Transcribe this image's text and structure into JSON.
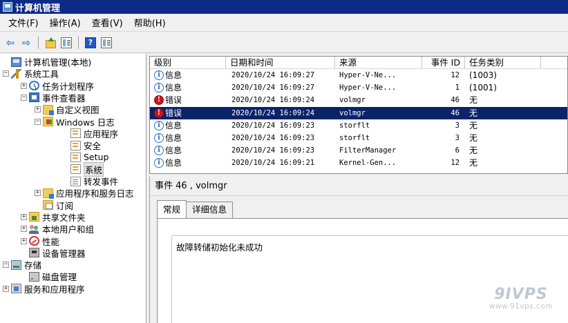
{
  "window": {
    "title": "计算机管理"
  },
  "menu": [
    "文件(F)",
    "操作(A)",
    "查看(V)",
    "帮助(H)"
  ],
  "toolbar": {
    "help_glyph": "?"
  },
  "tree": [
    {
      "label": "计算机管理(本地)",
      "exp": "none",
      "icon": "computer-icon",
      "cls": "ic-computer",
      "level": 0
    },
    {
      "label": "系统工具",
      "exp": "−",
      "icon": "tools-icon",
      "cls": "ic-tools",
      "level": 0
    },
    {
      "label": "任务计划程序",
      "exp": "+",
      "icon": "clock-icon",
      "cls": "ic-clock",
      "level": 1
    },
    {
      "label": "事件查看器",
      "exp": "−",
      "icon": "event-viewer-icon",
      "cls": "ic-log",
      "level": 1
    },
    {
      "label": "自定义视图",
      "exp": "+",
      "icon": "folder-icon",
      "cls": "ic-folder",
      "level": 2
    },
    {
      "label": "Windows 日志",
      "exp": "−",
      "icon": "windows-folder-icon",
      "cls": "ic-winfolder",
      "level": 2
    },
    {
      "label": "应用程序",
      "exp": "none",
      "icon": "log-icon",
      "cls": "ic-logfile",
      "level": 3
    },
    {
      "label": "安全",
      "exp": "none",
      "icon": "log-icon",
      "cls": "ic-logfile",
      "level": 3
    },
    {
      "label": "Setup",
      "exp": "none",
      "icon": "log-icon",
      "cls": "ic-logfile",
      "level": 3
    },
    {
      "label": "系统",
      "exp": "none",
      "icon": "log-icon",
      "cls": "ic-logfile",
      "level": 3,
      "selected": true
    },
    {
      "label": "转发事件",
      "exp": "none",
      "icon": "log-icon",
      "cls": "ic-logfile-plain",
      "level": 3
    },
    {
      "label": "应用程序和服务日志",
      "exp": "+",
      "icon": "folder-icon",
      "cls": "ic-folder",
      "level": 2
    },
    {
      "label": "订阅",
      "exp": "none",
      "icon": "subscription-icon",
      "cls": "ic-subscribe",
      "level": 2
    },
    {
      "label": "共享文件夹",
      "exp": "+",
      "icon": "shared-folder-icon",
      "cls": "ic-share",
      "level": 1
    },
    {
      "label": "本地用户和组",
      "exp": "+",
      "icon": "users-icon",
      "cls": "ic-users",
      "level": 1
    },
    {
      "label": "性能",
      "exp": "+",
      "icon": "performance-icon",
      "cls": "ic-perf",
      "level": 1
    },
    {
      "label": "设备管理器",
      "exp": "none",
      "icon": "device-manager-icon",
      "cls": "ic-device",
      "level": 1
    },
    {
      "label": "存储",
      "exp": "−",
      "icon": "storage-icon",
      "cls": "ic-storage",
      "level": 0
    },
    {
      "label": "磁盘管理",
      "exp": "none",
      "icon": "disk-icon",
      "cls": "ic-disk",
      "level": 1
    },
    {
      "label": "服务和应用程序",
      "exp": "+",
      "icon": "services-icon",
      "cls": "ic-services",
      "level": 0
    }
  ],
  "columns": [
    "级别",
    "日期和时间",
    "来源",
    "事件 ID",
    "任务类别"
  ],
  "events": [
    {
      "level": "信息",
      "type": "info",
      "datetime": "2020/10/24 16:09:27",
      "source": "Hyper-V-Ne...",
      "id": "12",
      "category": "(1003)"
    },
    {
      "level": "信息",
      "type": "info",
      "datetime": "2020/10/24 16:09:27",
      "source": "Hyper-V-Ne...",
      "id": "1",
      "category": "(1001)"
    },
    {
      "level": "错误",
      "type": "error",
      "datetime": "2020/10/24 16:09:24",
      "source": "volmgr",
      "id": "46",
      "category": "无"
    },
    {
      "level": "错误",
      "type": "error",
      "datetime": "2020/10/24 16:09:24",
      "source": "volmgr",
      "id": "46",
      "category": "无",
      "selected": true
    },
    {
      "level": "信息",
      "type": "info",
      "datetime": "2020/10/24 16:09:23",
      "source": "storflt",
      "id": "3",
      "category": "无"
    },
    {
      "level": "信息",
      "type": "info",
      "datetime": "2020/10/24 16:09:23",
      "source": "storflt",
      "id": "3",
      "category": "无"
    },
    {
      "level": "信息",
      "type": "info",
      "datetime": "2020/10/24 16:09:23",
      "source": "FilterManager",
      "id": "6",
      "category": "无"
    },
    {
      "level": "信息",
      "type": "info",
      "datetime": "2020/10/24 16:09:21",
      "source": "Kernel-Gen...",
      "id": "12",
      "category": "无"
    }
  ],
  "detail": {
    "title": "事件 46 , volmgr",
    "tabs": [
      "常规",
      "详细信息"
    ],
    "message": "故障转储初始化未成功"
  },
  "watermark": {
    "logo": "9IVPS",
    "url": "www.91vps.com"
  },
  "colors": {
    "titlebar": "#0c2b86",
    "selection": "#0a246a",
    "error": "#c8161d",
    "info": "#2d6ac4"
  }
}
